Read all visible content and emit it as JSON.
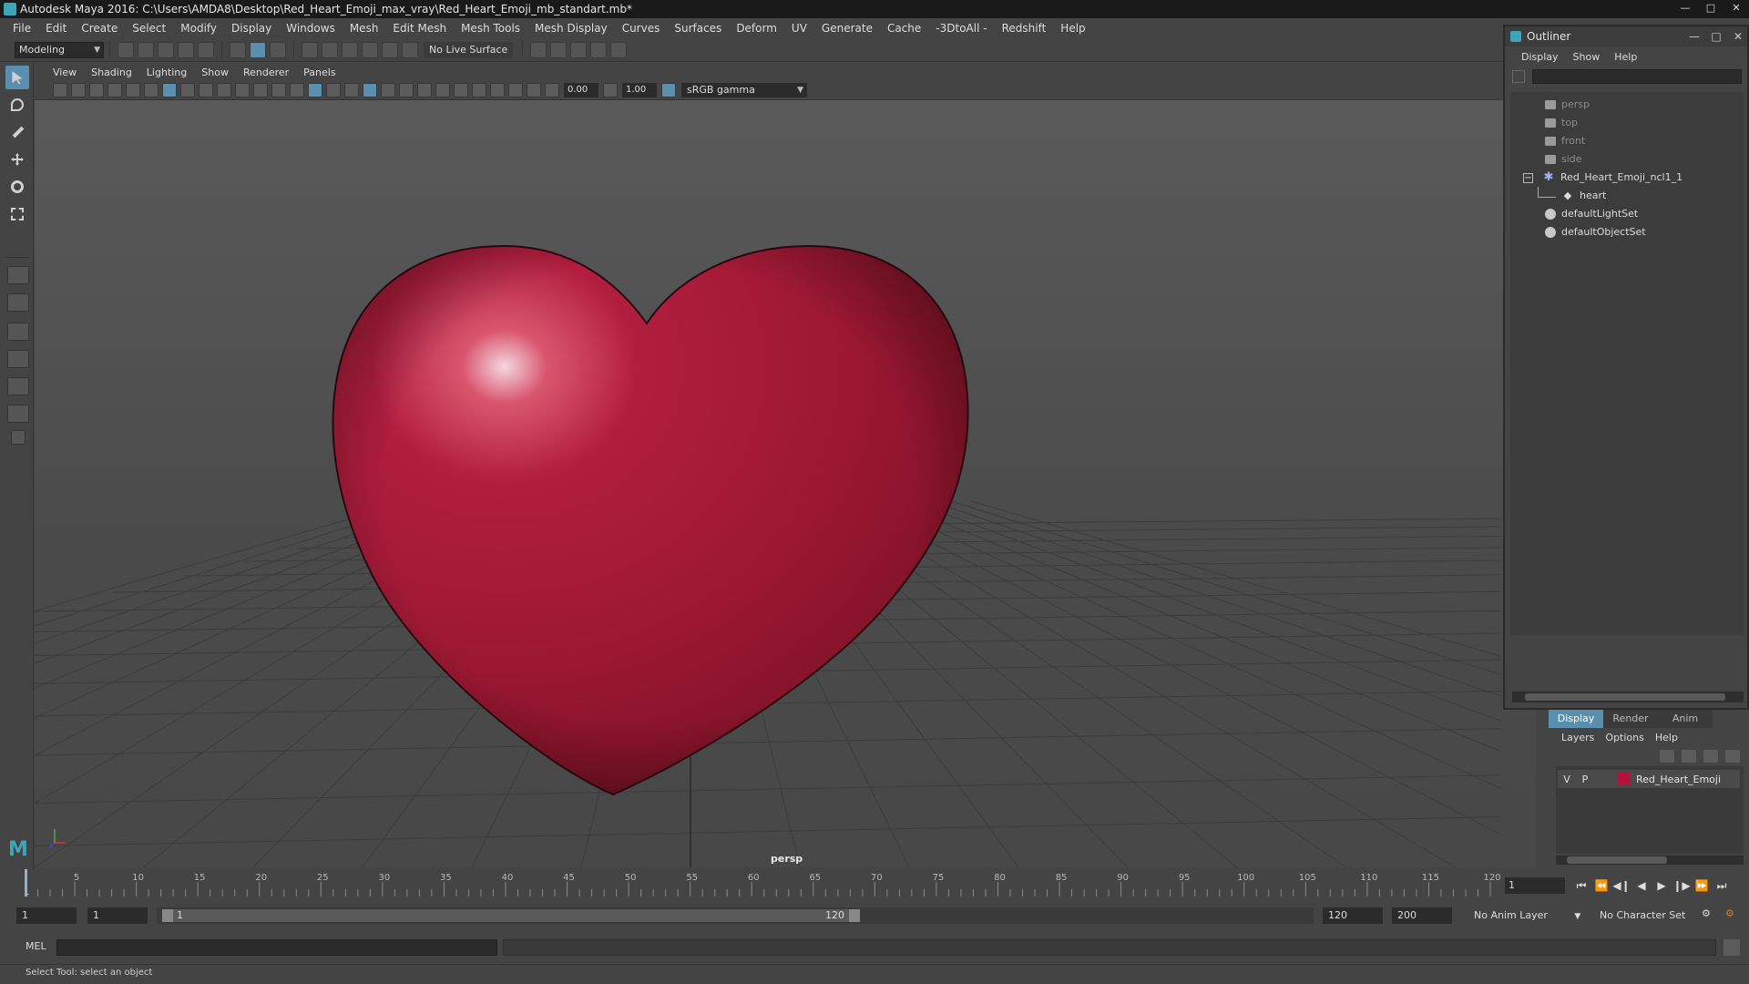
{
  "window": {
    "title": "Autodesk Maya 2016: C:\\Users\\AMDA8\\Desktop\\Red_Heart_Emoji_max_vray\\Red_Heart_Emoji_mb_standart.mb*"
  },
  "menubar": [
    "File",
    "Edit",
    "Create",
    "Select",
    "Modify",
    "Display",
    "Windows",
    "Mesh",
    "Edit Mesh",
    "Mesh Tools",
    "Mesh Display",
    "Curves",
    "Surfaces",
    "Deform",
    "UV",
    "Generate",
    "Cache",
    "-3DtoAll -",
    "Redshift",
    "Help"
  ],
  "statusline": {
    "mode": "Modeling",
    "live_surface": "No Live Surface"
  },
  "panel_menu": [
    "View",
    "Shading",
    "Lighting",
    "Show",
    "Renderer",
    "Panels"
  ],
  "panel_toolbar": {
    "exposure": "0.00",
    "gamma": "1.00",
    "color_space": "sRGB gamma"
  },
  "viewport": {
    "camera_label": "persp",
    "heart_color": "#9e1a33"
  },
  "outliner": {
    "title": "Outliner",
    "menu": [
      "Display",
      "Show",
      "Help"
    ],
    "items": [
      {
        "label": "persp",
        "type": "camera",
        "dim": true
      },
      {
        "label": "top",
        "type": "camera",
        "dim": true
      },
      {
        "label": "front",
        "type": "camera",
        "dim": true
      },
      {
        "label": "side",
        "type": "camera",
        "dim": true
      },
      {
        "label": "Red_Heart_Emoji_ncl1_1",
        "type": "group",
        "dim": false
      },
      {
        "label": "heart",
        "type": "mesh",
        "dim": false
      },
      {
        "label": "defaultLightSet",
        "type": "set",
        "dim": false
      },
      {
        "label": "defaultObjectSet",
        "type": "set",
        "dim": false
      }
    ]
  },
  "layer_editor": {
    "tabs": [
      "Display",
      "Render",
      "Anim"
    ],
    "active_tab": "Display",
    "menu": [
      "Layers",
      "Options",
      "Help"
    ],
    "layer": {
      "v": "V",
      "p": "P",
      "name": "Red_Heart_Emoji",
      "color": "#b0123a"
    }
  },
  "timeline": {
    "ticks": [
      1,
      5,
      10,
      15,
      20,
      25,
      30,
      35,
      40,
      45,
      50,
      55,
      60,
      65,
      70,
      75,
      80,
      85,
      90,
      95,
      100,
      105,
      110,
      115,
      120
    ],
    "current_frame": "1"
  },
  "range": {
    "start": "1",
    "playback_start": "1",
    "range_start_label": "1",
    "range_end_label": "120",
    "playback_end": "120",
    "end": "200",
    "anim_layer": "No Anim Layer",
    "character_set": "No Character Set"
  },
  "command": {
    "label": "MEL"
  },
  "help_line": "Select Tool: select an object"
}
